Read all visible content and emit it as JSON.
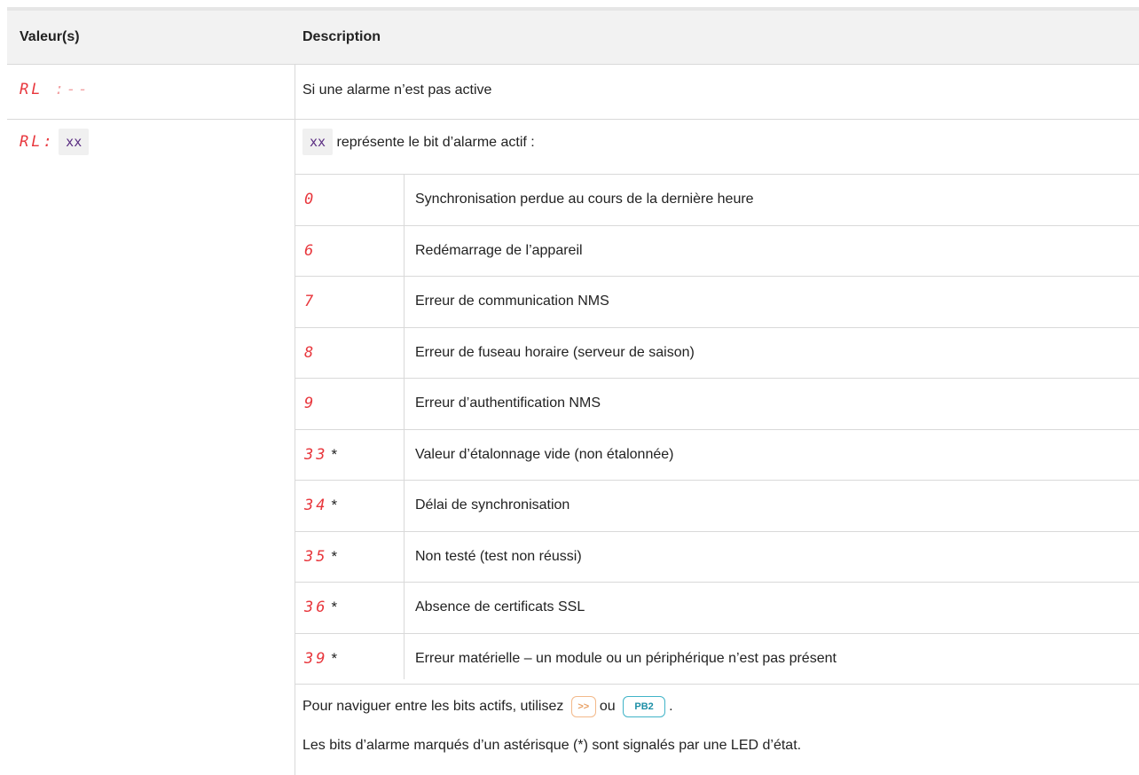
{
  "header": {
    "col1": "Valeur(s)",
    "col2": "Description"
  },
  "rows": [
    {
      "display_prefix": "RL",
      "display_suffix": ":--",
      "description": "Si une alarme n’est pas active"
    },
    {
      "display_prefix": "RL:",
      "code": "xx",
      "intro_code": "xx",
      "intro_text": "représente le bit d’alarme actif :"
    }
  ],
  "alarm_bits": [
    {
      "digit": "0",
      "star": "",
      "text": "Synchronisation perdue au cours de la dernière heure"
    },
    {
      "digit": "6",
      "star": "",
      "text": "Redémarrage de l’appareil"
    },
    {
      "digit": "7",
      "star": "",
      "text": "Erreur de communication NMS"
    },
    {
      "digit": "8",
      "star": "",
      "text": "Erreur de fuseau horaire (serveur de saison)"
    },
    {
      "digit": "9",
      "star": "",
      "text": "Erreur d’authentification NMS"
    },
    {
      "digit": "33",
      "star": "*",
      "text": "Valeur d’étalonnage vide (non étalonnée)"
    },
    {
      "digit": "34",
      "star": "*",
      "text": "Délai de synchronisation"
    },
    {
      "digit": "35",
      "star": "*",
      "text": "Non testé (test non réussi)"
    },
    {
      "digit": "36",
      "star": "*",
      "text": "Absence de certificats SSL"
    },
    {
      "digit": "39",
      "star": "*",
      "text": "Erreur matérielle – un module ou un périphérique n’est pas présent"
    }
  ],
  "footer": {
    "nav_prefix": "Pour naviguer entre les bits actifs, utilisez",
    "nav_or": "ou",
    "nav_end": ".",
    "btn_next": ">>",
    "btn_pb2": "PB2",
    "note": "Les bits d’alarme marqués d’un astérisque (*) sont signalés par une LED d’état."
  },
  "colors": {
    "segment_red": "#e8363c",
    "code_purple": "#5a2d82",
    "btn_orange": "#f3b98a",
    "btn_teal": "#40b4c8"
  }
}
